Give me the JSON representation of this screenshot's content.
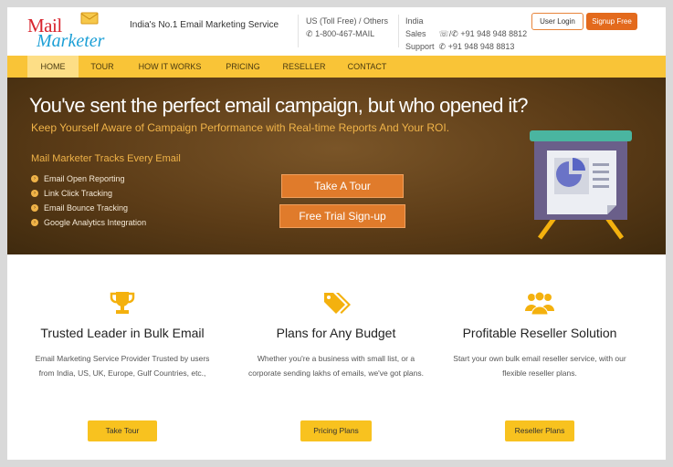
{
  "header": {
    "logo_line1": "Mail",
    "logo_line2": "Marketer",
    "tagline": "India's No.1 Email Marketing Service",
    "us_label": "US (Toll Free) / Others",
    "us_phone": "1-800-467-MAIL",
    "india_label": "India",
    "sales_label": "Sales",
    "sales_phone": "+91 948 948 8812",
    "support_label": "Support",
    "support_phone": "+91 948 948 8813",
    "login_label": "User Login",
    "signup_label": "Signup Free"
  },
  "nav": {
    "items": [
      {
        "label": "HOME"
      },
      {
        "label": "TOUR"
      },
      {
        "label": "HOW IT WORKS"
      },
      {
        "label": "PRICING"
      },
      {
        "label": "RESELLER"
      },
      {
        "label": "CONTACT"
      }
    ],
    "active": "HOME"
  },
  "hero": {
    "title": "You've sent the perfect email campaign, but who opened it?",
    "subtitle": "Keep Yourself Aware of Campaign Performance with Real-time Reports And Your ROI.",
    "tracks_heading": "Mail Marketer Tracks Every Email",
    "features": [
      "Email Open Reporting",
      "Link Click Tracking",
      "Email Bounce Tracking",
      "Google Analytics Integration"
    ],
    "tour_button": "Take A Tour",
    "trial_button": "Free Trial Sign-up"
  },
  "columns": [
    {
      "icon": "trophy-icon",
      "title": "Trusted Leader in Bulk Email",
      "text": "Email Marketing Service Provider Trusted by users from India, US, UK, Europe, Gulf Countries, etc.,",
      "button": "Take Tour"
    },
    {
      "icon": "price-tags-icon",
      "title": "Plans for Any Budget",
      "text": "Whether you're a business with small list, or a corporate sending lakhs of emails, we've got plans.",
      "button": "Pricing Plans"
    },
    {
      "icon": "users-group-icon",
      "title": "Profitable Reseller Solution",
      "text": "Start your own bulk email reseller service, with our flexible reseller plans.",
      "button": "Reseller Plans"
    }
  ],
  "colors": {
    "nav_bar": "#f9c437",
    "nav_active": "#fdde86",
    "signup_button": "#e36a1d",
    "hero_accent": "#f0b348",
    "hero_button": "#e07b2b",
    "column_button": "#f8c21f",
    "icon_accent": "#f4b10e"
  }
}
